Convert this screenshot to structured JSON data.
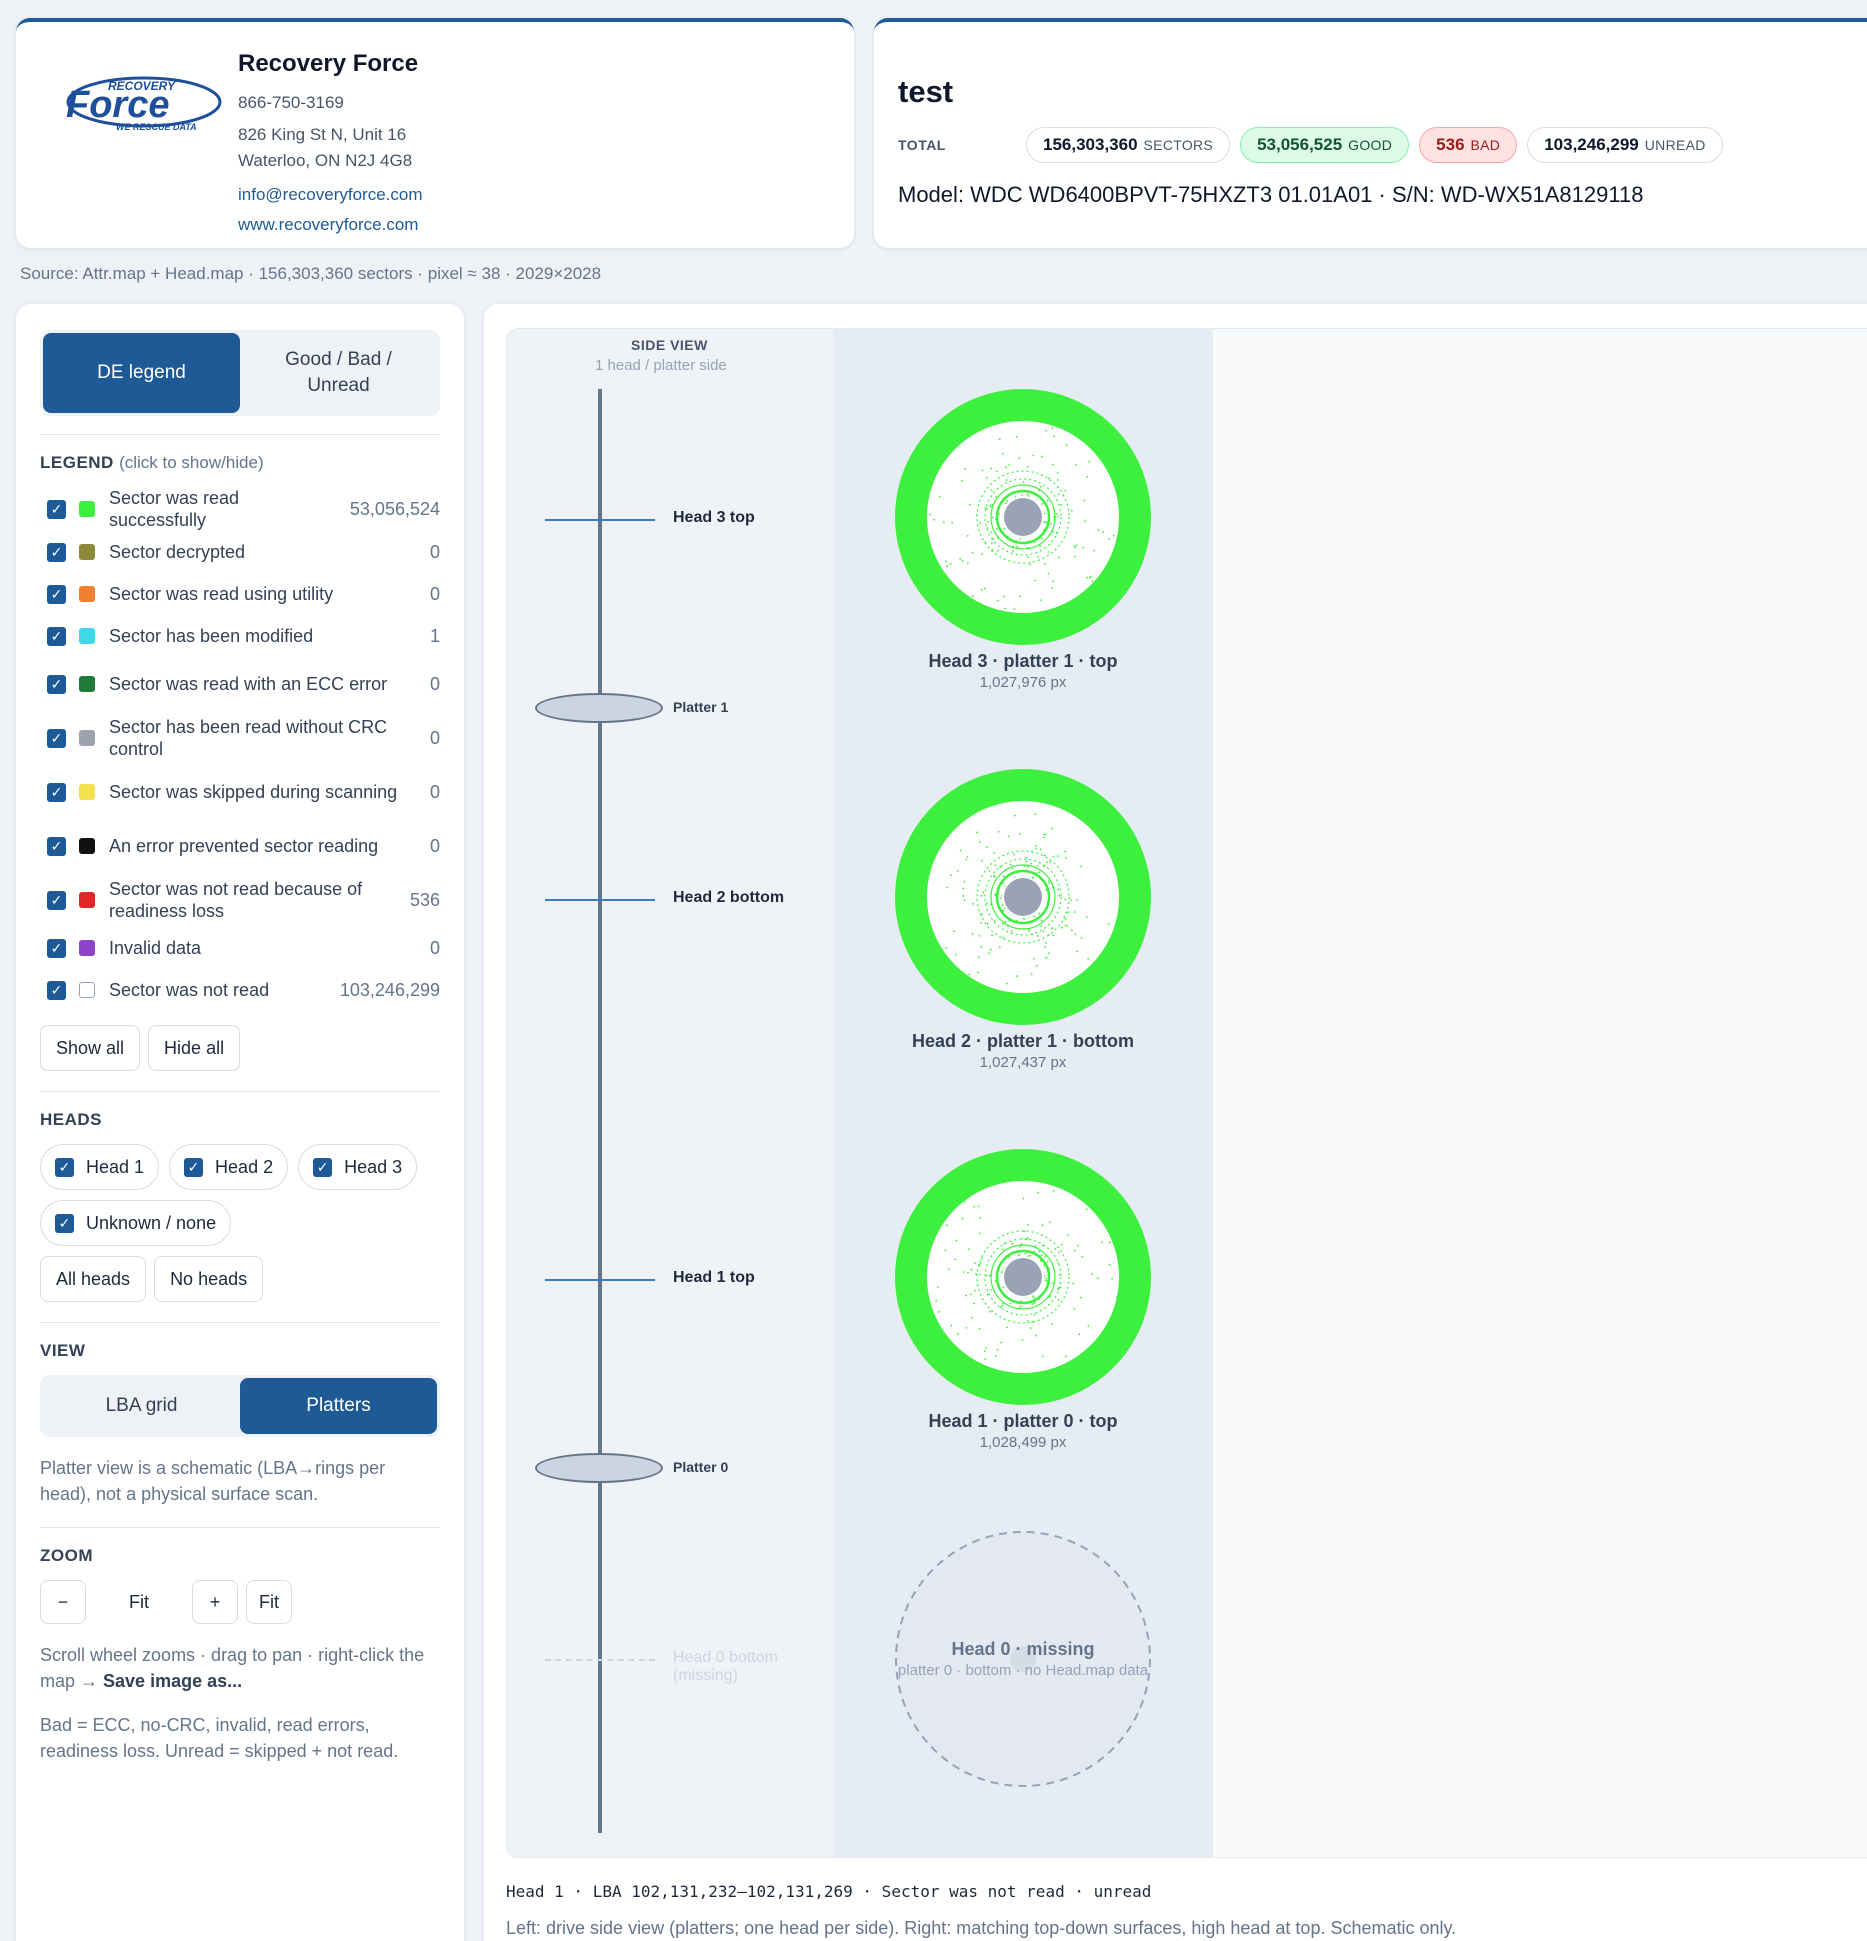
{
  "company": {
    "logo_text_top": "RECOVERY",
    "logo_text_main": "Force",
    "logo_text_bottom": "WE RESCUE DATA",
    "name": "Recovery Force",
    "phone": "866-750-3169",
    "address_1": "826 King St N, Unit 16",
    "address_2": "Waterloo, ON  N2J 4G8",
    "email": "info@recoveryforce.com",
    "website": "www.recoveryforce.com"
  },
  "drive": {
    "title": "test",
    "total_label": "TOTAL",
    "sectors_value": "156,303,360",
    "sectors_unit": "SECTORS",
    "good_value": "53,056,525",
    "good_unit": "GOOD",
    "bad_value": "536",
    "bad_unit": "BAD",
    "unread_value": "103,246,299",
    "unread_unit": "UNREAD",
    "model_line": "Model: WDC WD6400BPVT-75HXZT3 01.01A01 · S/N: WD-WX51A8129118"
  },
  "source_line": "Source: Attr.map + Head.map · 156,303,360 sectors · pixel ≈ 38 · 2029×2028",
  "sidebar": {
    "mode_tabs": {
      "de_legend": "DE legend",
      "good_bad_unread_1": "Good / Bad /",
      "good_bad_unread_2": "Unread"
    },
    "legend_title": "LEGEND",
    "legend_hint": "(click to show/hide)",
    "legend_items": [
      {
        "label": "Sector was read successfully",
        "count": "53,056,524",
        "color": "#3ef03e"
      },
      {
        "label": "Sector decrypted",
        "count": "0",
        "color": "#8a8a3a"
      },
      {
        "label": "Sector was read using utility",
        "count": "0",
        "color": "#f08030"
      },
      {
        "label": "Sector has been modified",
        "count": "1",
        "color": "#40d8e8"
      },
      {
        "label": "Sector was read with an ECC error",
        "count": "0",
        "color": "#1f7a3a"
      },
      {
        "label": "Sector has been read without CRC control",
        "count": "0",
        "color": "#9ca3af"
      },
      {
        "label": "Sector was skipped during scanning",
        "count": "0",
        "color": "#f5e050"
      },
      {
        "label": "An error prevented sector reading",
        "count": "0",
        "color": "#111111"
      },
      {
        "label": "Sector was not read because of readiness loss",
        "count": "536",
        "color": "#e02828"
      },
      {
        "label": "Invalid data",
        "count": "0",
        "color": "#8e44c8"
      },
      {
        "label": "Sector was not read",
        "count": "103,246,299",
        "color": "#ffffff"
      }
    ],
    "show_all": "Show all",
    "hide_all": "Hide all",
    "heads_title": "HEADS",
    "heads": [
      "Head 1",
      "Head 2",
      "Head 3",
      "Unknown / none"
    ],
    "all_heads": "All heads",
    "no_heads": "No heads",
    "view_title": "VIEW",
    "view_lba": "LBA grid",
    "view_platters": "Platters",
    "view_note": "Platter view is a schematic (LBA→rings per head), not a physical surface scan.",
    "zoom_title": "ZOOM",
    "zoom_minus": "−",
    "zoom_fit_text": "Fit",
    "zoom_plus": "+",
    "zoom_fit_btn": "Fit",
    "zoom_note_1": "Scroll wheel zooms · drag to pan · right-click the map → ",
    "zoom_note_bold": "Save image as...",
    "bad_note": "Bad = ECC, no-CRC, invalid, read errors, readiness loss. Unread = skipped + not read."
  },
  "side_view": {
    "title": "SIDE VIEW",
    "subtitle": "1 head / platter side",
    "head3": "Head 3 top",
    "platter1": "Platter 1",
    "head2": "Head 2 bottom",
    "head1": "Head 1 top",
    "platter0": "Platter 0",
    "head0": "Head 0 bottom (missing)"
  },
  "disks": [
    {
      "title": "Head 3 · platter 1 · top",
      "px": "1,027,976 px"
    },
    {
      "title": "Head 2 · platter 1 · bottom",
      "px": "1,027,437 px"
    },
    {
      "title": "Head 1 · platter 0 · top",
      "px": "1,028,499 px"
    }
  ],
  "missing_disk": {
    "title": "Head 0 · missing",
    "sub": "platter 0 · bottom · no Head.map data"
  },
  "hover_line": "Head 1 · LBA 102,131,232–102,131,269 · Sector was not read · unread",
  "caption_line": "Left: drive side view (platters; one head per side). Right: matching top-down surfaces, high head at top. Schematic only.",
  "colors": {
    "accent": "#1e5a96",
    "good": "#3ef03e",
    "hub": "#9aa3b5"
  }
}
